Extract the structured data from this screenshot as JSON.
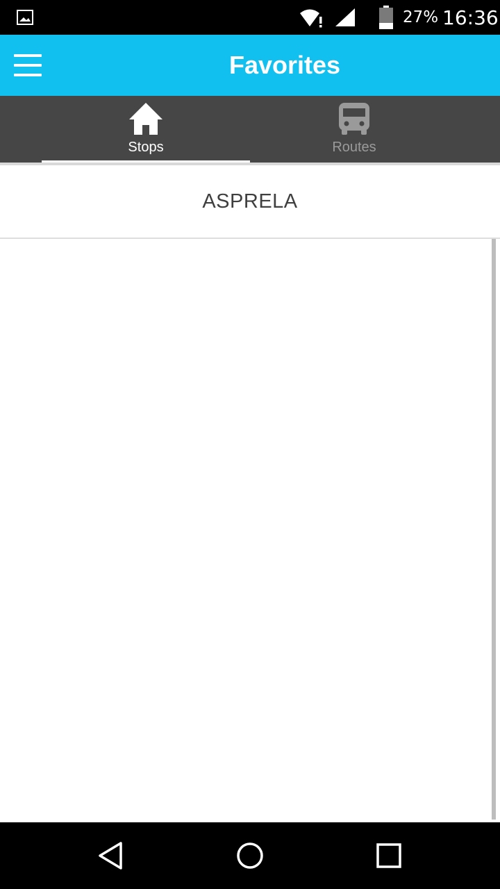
{
  "status_bar": {
    "battery_text": "27%",
    "time": "16:36",
    "icons": [
      "image-notification-icon",
      "wifi-alert-icon",
      "cellular-signal-icon",
      "battery-icon"
    ]
  },
  "app_bar": {
    "title": "Favorites",
    "menu_icon": "hamburger-menu-icon",
    "background_color": "#12c0f0"
  },
  "tabs": [
    {
      "label": "Stops",
      "icon": "home-icon",
      "selected": true
    },
    {
      "label": "Routes",
      "icon": "bus-icon",
      "selected": false
    }
  ],
  "favorites": {
    "stops": [
      {
        "name": "ASPRELA"
      }
    ]
  },
  "nav_bar": {
    "buttons": [
      "back-icon",
      "home-circle-icon",
      "recents-square-icon"
    ]
  }
}
